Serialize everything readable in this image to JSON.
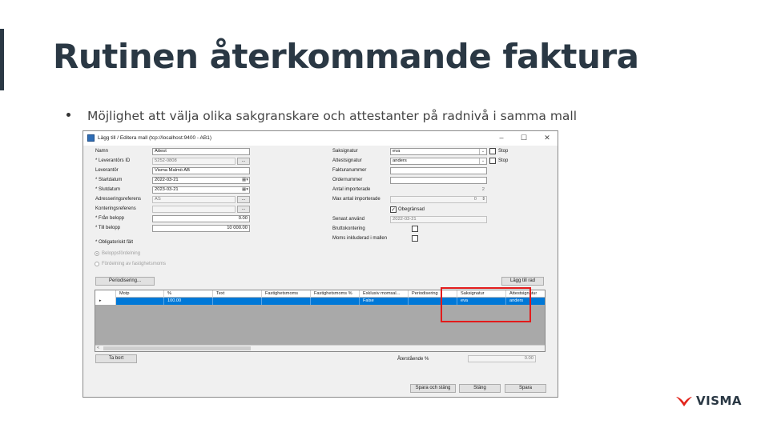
{
  "slide": {
    "title": "Rutinen återkommande faktura",
    "bullet": "Möjlighet att välja olika sakgranskare och attestanter på radnivå i samma mall"
  },
  "dialog": {
    "title": "Lägg till / Editera mall (tcp://localhost:9400 - AB1)",
    "controls": {
      "minimize": "–",
      "maximize": "☐",
      "close": "✕"
    },
    "left": {
      "namn": {
        "label": "Namn",
        "value": "Attest"
      },
      "leverantors_id": {
        "label": "* Leverantörs ID",
        "value": "5252-0808"
      },
      "leverantor": {
        "label": "Leverantör",
        "value": "Visma Malmö AB"
      },
      "startdatum": {
        "label": "* Startdatum",
        "value": "2022-03-21"
      },
      "slutdatum": {
        "label": "* Slutdatum",
        "value": "2023-03-21"
      },
      "adresseringsreferens": {
        "label": "Adresseringsreferens",
        "value": "AS"
      },
      "konteringsreferens": {
        "label": "Konteringsreferens",
        "value": ""
      },
      "fran_belopp": {
        "label": "* Från belopp",
        "value": "0.00"
      },
      "till_belopp": {
        "label": "* Till belopp",
        "value": "10 000.00"
      },
      "obligatoriskt": "* Obligatoriskt fält",
      "radio_belopp": "Beloppsfördelning",
      "radio_fastighet": "Fördelning av fastighetsmoms",
      "dots": "..."
    },
    "right": {
      "saksignatur": {
        "label": "Saksignatur",
        "value": "eva",
        "stop": "Stop"
      },
      "attestsignatur": {
        "label": "Attestsignatur",
        "value": "anders",
        "stop": "Stop"
      },
      "fakturanummer": {
        "label": "Fakturanummer",
        "value": ""
      },
      "ordernummer": {
        "label": "Ordernummer",
        "value": ""
      },
      "antal_importerade": {
        "label": "Antal importerade",
        "value": "2"
      },
      "max_antal": {
        "label": "Max antal importerade",
        "value": "0"
      },
      "obegransad": {
        "label": "Obegränsad",
        "checked": true
      },
      "senast_anvand": {
        "label": "Senast använd",
        "value": "2022-03-21"
      },
      "bruttokontering": {
        "label": "Bruttokontering",
        "checked": false
      },
      "moms_inkluderad": {
        "label": "Moms inkluderad i mallen",
        "checked": false
      }
    },
    "buttons": {
      "periodisering": "Periodisering...",
      "lagg_till_rad": "Lägg till rad",
      "ta_bort": "Ta bort",
      "spara_och_stang": "Spara och stäng",
      "stang": "Stäng",
      "spara": "Spara"
    },
    "grid": {
      "columns": [
        "Motp",
        "%",
        "Text",
        "Fastighetsmoms",
        "Fastighetsmoms %",
        "Exklusiv momsal...",
        "Periodisering",
        "Saksignatur",
        "Attestsignatur"
      ],
      "row": [
        "",
        "100.00",
        "",
        "",
        "",
        "False",
        "",
        "eva",
        "anders"
      ],
      "hscroll_left": "<"
    },
    "aterstaende": {
      "label": "Återstående %",
      "value": "0.00"
    }
  },
  "logo": {
    "text": "VISMA",
    "color": "#e2231a"
  }
}
